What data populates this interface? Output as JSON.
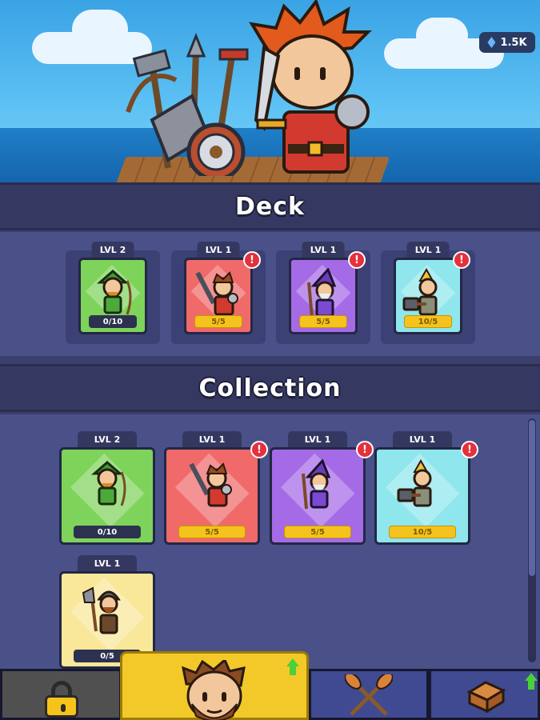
{
  "currency": {
    "gems": "1.5K",
    "icon": "gem-icon",
    "color": "#66b6ff"
  },
  "sections": {
    "deck_title": "Deck",
    "collection_title": "Collection"
  },
  "deck": [
    {
      "level": "LVL 2",
      "progress": "0/10",
      "color": "#7ed35a",
      "character": "archer",
      "alert": false,
      "full": false
    },
    {
      "level": "LVL 1",
      "progress": "5/5",
      "color": "#f06a6a",
      "character": "swordsman",
      "alert": true,
      "full": true
    },
    {
      "level": "LVL 1",
      "progress": "5/5",
      "color": "#a56ae6",
      "character": "wizard",
      "alert": true,
      "full": true
    },
    {
      "level": "LVL 1",
      "progress": "10/5",
      "color": "#8fe6ec",
      "character": "hammer-warrior",
      "alert": true,
      "full": true
    }
  ],
  "collection": [
    {
      "level": "LVL 2",
      "progress": "0/10",
      "color": "#7ed35a",
      "character": "archer",
      "alert": false,
      "full": false
    },
    {
      "level": "LVL 1",
      "progress": "5/5",
      "color": "#f06a6a",
      "character": "swordsman",
      "alert": true,
      "full": true
    },
    {
      "level": "LVL 1",
      "progress": "5/5",
      "color": "#a56ae6",
      "character": "wizard",
      "alert": true,
      "full": true
    },
    {
      "level": "LVL 1",
      "progress": "10/5",
      "color": "#8fe6ec",
      "character": "hammer-warrior",
      "alert": true,
      "full": true
    },
    {
      "level": "LVL 1",
      "progress": "0/5",
      "color": "#f9e79a",
      "character": "viking-axeman",
      "alert": false,
      "full": false
    }
  ],
  "alert_mark": "!",
  "nav": [
    {
      "name": "lock-tab",
      "icon": "lock-icon"
    },
    {
      "name": "hero-tab",
      "icon": "hero-face-icon",
      "active": true
    },
    {
      "name": "battle-tab",
      "icon": "crossed-oars-icon"
    },
    {
      "name": "chest-tab",
      "icon": "treasure-chest-icon"
    }
  ]
}
